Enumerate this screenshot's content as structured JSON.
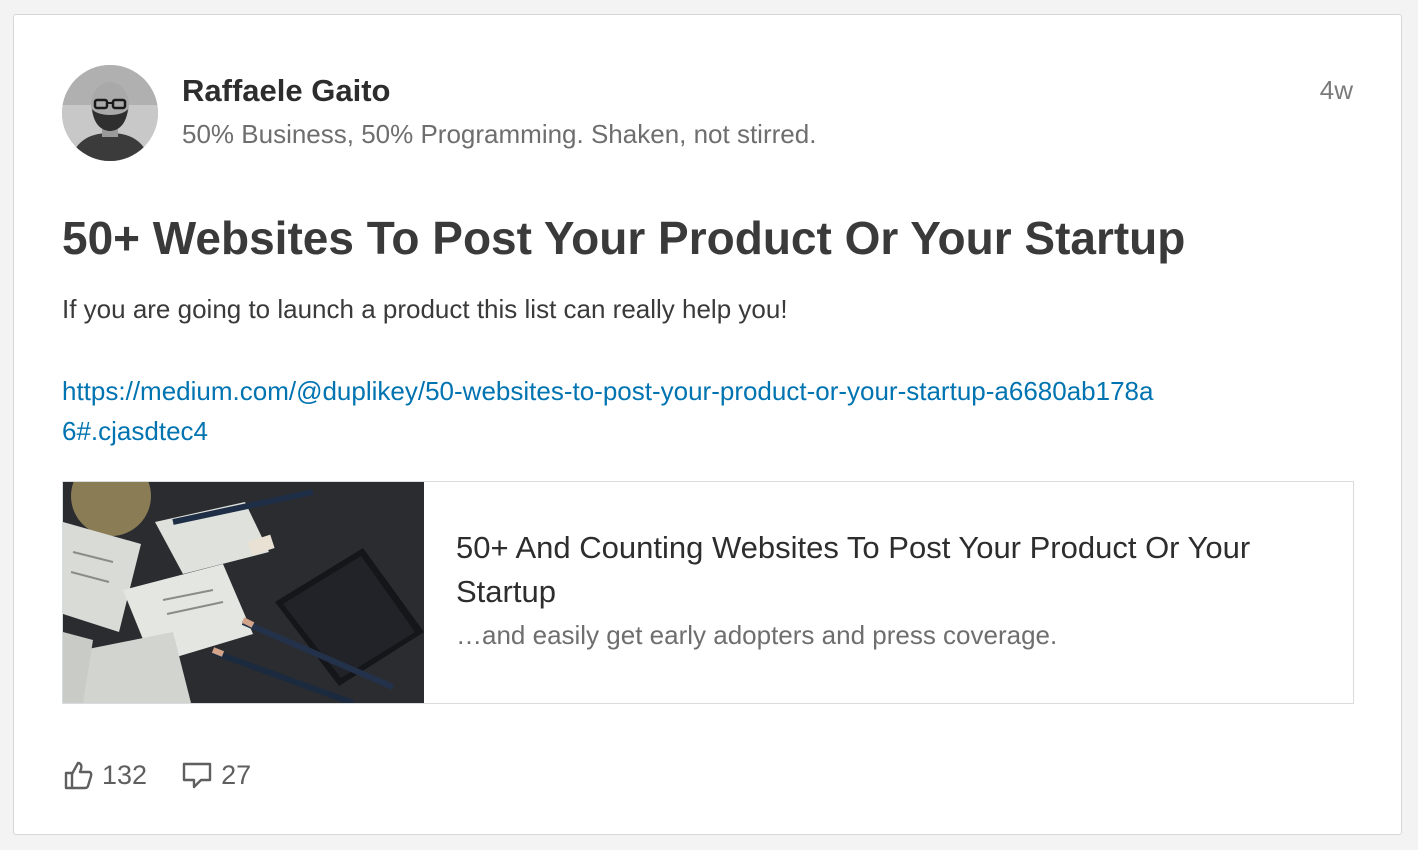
{
  "post": {
    "author": {
      "name": "Raffaele Gaito",
      "headline": "50% Business, 50% Programming. Shaken, not stirred."
    },
    "timestamp": "4w",
    "title": "50+ Websites To Post Your Product Or Your Startup",
    "body": "If you are going to launch a product this list can really help you!",
    "link": "https://medium.com/@duplikey/50-websites-to-post-your-product-or-your-startup-a6680ab178a6#.cjasdtec4"
  },
  "preview": {
    "title": "50+ And Counting Websites To Post Your Product Or Your Startup",
    "description": "…and easily get early adopters and press coverage."
  },
  "actions": {
    "like_icon": "thumbs-up-icon",
    "likes": "132",
    "comment_icon": "comment-icon",
    "comments": "27"
  },
  "colors": {
    "link": "#0073b1",
    "title": "#3a3a3a",
    "muted": "#6e6e6e"
  }
}
